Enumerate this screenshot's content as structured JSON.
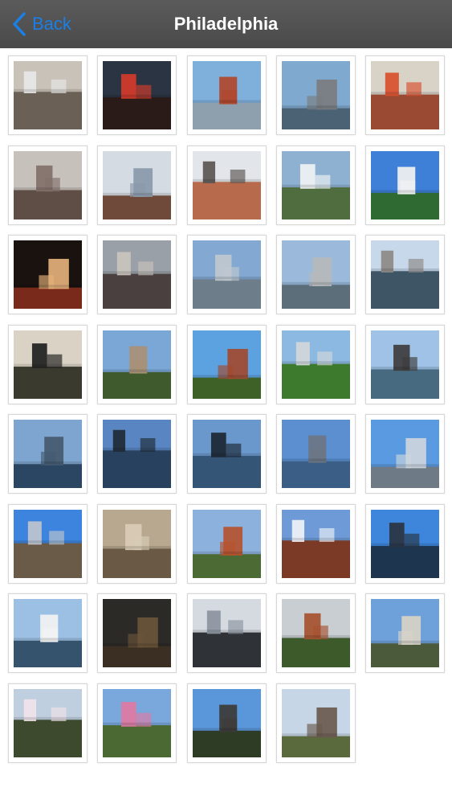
{
  "navbar": {
    "back_label": "Back",
    "title": "Philadelphia"
  },
  "colors": {
    "navbar": "#4f4f4f",
    "back": "#1a7fe6",
    "title": "#ffffff",
    "tile_border": "#d7d7d7"
  },
  "photos": [
    {
      "icon": "statue-photo-icon",
      "sky": "#c9c2b8",
      "ground": "#6b6055",
      "accent": "#e8e8e8"
    },
    {
      "icon": "city-hall-night-photo-icon",
      "sky": "#2b3442",
      "ground": "#2a1b18",
      "accent": "#d53a2a"
    },
    {
      "icon": "red-church-photo-icon",
      "sky": "#7fb0dc",
      "ground": "#8e9fad",
      "accent": "#b0472c"
    },
    {
      "icon": "battleship-photo-icon",
      "sky": "#7fa9cf",
      "ground": "#4b6174",
      "accent": "#7a7d80"
    },
    {
      "icon": "city-hall-flowers-photo-icon",
      "sky": "#d8d2c7",
      "ground": "#9a4a33",
      "accent": "#d94f2c"
    },
    {
      "icon": "foggy-city-photo-icon",
      "sky": "#c7c1bc",
      "ground": "#5f4e46",
      "accent": "#82706a"
    },
    {
      "icon": "skyscraper-photo-icon",
      "sky": "#d4dbe2",
      "ground": "#6f4a3a",
      "accent": "#8a9aaa"
    },
    {
      "icon": "skyline-trees-photo-icon",
      "sky": "#e2e6ea",
      "ground": "#b86a4c",
      "accent": "#5b5552"
    },
    {
      "icon": "fountain-photo-icon",
      "sky": "#8fb1d1",
      "ground": "#4f6d3f",
      "accent": "#f0f2f4"
    },
    {
      "icon": "balloon-photo-icon",
      "sky": "#3e7fd7",
      "ground": "#2f6a33",
      "accent": "#f2f2f2"
    },
    {
      "icon": "city-hall-lit-photo-icon",
      "sky": "#1a120f",
      "ground": "#7a2a1a",
      "accent": "#e3b07a"
    },
    {
      "icon": "gray-buildings-photo-icon",
      "sky": "#9aa0a8",
      "ground": "#4a4040",
      "accent": "#c9c3bd"
    },
    {
      "icon": "river-bridge-photo-icon",
      "sky": "#83a9d3",
      "ground": "#6d7d89",
      "accent": "#c0c8cf"
    },
    {
      "icon": "river-cityscape-photo-icon",
      "sky": "#9bbadb",
      "ground": "#5d6e7b",
      "accent": "#b6b9bc"
    },
    {
      "icon": "boathouse-photo-icon",
      "sky": "#c6d8ea",
      "ground": "#3e5566",
      "accent": "#8d8a86"
    },
    {
      "icon": "elephant-statue-photo-icon",
      "sky": "#d9d2c5",
      "ground": "#3a3a2e",
      "accent": "#1f1f1f"
    },
    {
      "icon": "park-fountain-photo-icon",
      "sky": "#7aa7d6",
      "ground": "#3f5a2d",
      "accent": "#a89077"
    },
    {
      "icon": "museum-dome-photo-icon",
      "sky": "#5da2e0",
      "ground": "#3e6128",
      "accent": "#a24a30"
    },
    {
      "icon": "green-park-photo-icon",
      "sky": "#8cb9e2",
      "ground": "#3e7a2e",
      "accent": "#d3d7da"
    },
    {
      "icon": "river-factory-photo-icon",
      "sky": "#9fc2e6",
      "ground": "#486a80",
      "accent": "#3d3d3d"
    },
    {
      "icon": "dusk-skyline-photo-icon",
      "sky": "#7ea5cf",
      "ground": "#2b4663",
      "accent": "#445a70"
    },
    {
      "icon": "ben-franklin-bridge-photo-icon",
      "sky": "#5986c2",
      "ground": "#27415f",
      "accent": "#1f2a36"
    },
    {
      "icon": "bridge-river-photo-icon",
      "sky": "#6b98cc",
      "ground": "#355577",
      "accent": "#1c2633"
    },
    {
      "icon": "river-skyline-photo-icon",
      "sky": "#5b8fd0",
      "ground": "#3a5e86",
      "accent": "#6c7684"
    },
    {
      "icon": "city-skyline-photo-icon",
      "sky": "#5a9ae0",
      "ground": "#6e7a86",
      "accent": "#cdd5dd"
    },
    {
      "icon": "harbor-skyline-photo-icon",
      "sky": "#3c84dd",
      "ground": "#6a5a48",
      "accent": "#bfc6cd"
    },
    {
      "icon": "stone-columns-photo-icon",
      "sky": "#b7a88f",
      "ground": "#6a5a45",
      "accent": "#d9ccb7"
    },
    {
      "icon": "brick-hall-photo-icon",
      "sky": "#8cb1dd",
      "ground": "#4c6a34",
      "accent": "#b5532f"
    },
    {
      "icon": "independence-hall-photo-icon",
      "sky": "#6e9bd7",
      "ground": "#7b3a25",
      "accent": "#f0f3f7"
    },
    {
      "icon": "bridge-tower-photo-icon",
      "sky": "#3e86db",
      "ground": "#1e3550",
      "accent": "#2a3442"
    },
    {
      "icon": "ferry-boat-photo-icon",
      "sky": "#9cc0e4",
      "ground": "#36536e",
      "accent": "#f3f3f3"
    },
    {
      "icon": "liberty-bell-photo-icon",
      "sky": "#2c2a27",
      "ground": "#3b2e22",
      "accent": "#6a553a"
    },
    {
      "icon": "glass-tower-photo-icon",
      "sky": "#d5dae0",
      "ground": "#2f3338",
      "accent": "#8a949e"
    },
    {
      "icon": "tower-trees-photo-icon",
      "sky": "#c9ced3",
      "ground": "#3c5a2a",
      "accent": "#a6522f"
    },
    {
      "icon": "city-hall-day-photo-icon",
      "sky": "#6ea0d9",
      "ground": "#4a5a3a",
      "accent": "#d7d2c7"
    },
    {
      "icon": "cherry-blossoms-photo-icon",
      "sky": "#c0cfe0",
      "ground": "#3d4a2e",
      "accent": "#f1e4ea"
    },
    {
      "icon": "pink-blossoms-photo-icon",
      "sky": "#7aa8dc",
      "ground": "#4b6a33",
      "accent": "#e07aa2"
    },
    {
      "icon": "lighthouse-photo-icon",
      "sky": "#5a97da",
      "ground": "#2e3b25",
      "accent": "#3d3b37"
    },
    {
      "icon": "victorian-house-photo-icon",
      "sky": "#c7d6e6",
      "ground": "#5b6a3c",
      "accent": "#6a5a4e"
    }
  ]
}
